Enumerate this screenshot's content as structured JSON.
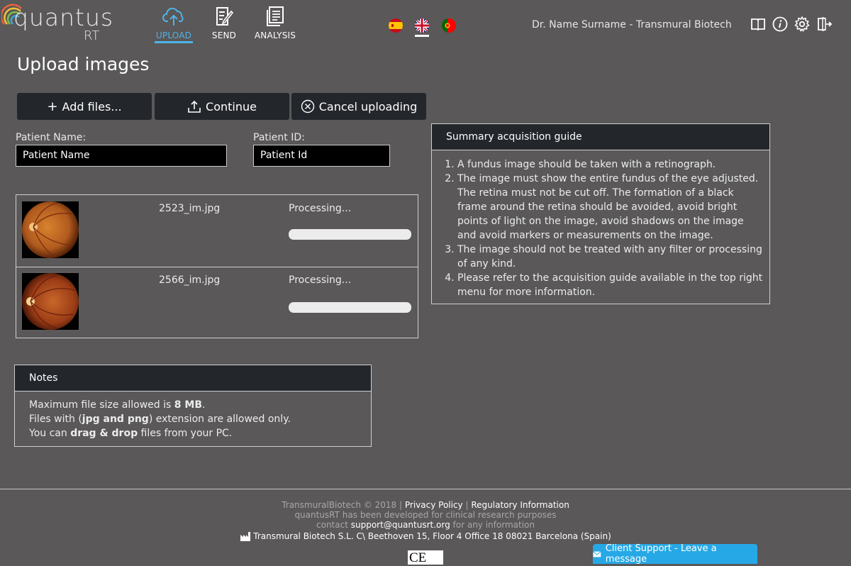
{
  "header": {
    "logo": {
      "word": "quantus",
      "suffix": "RT"
    },
    "nav": [
      {
        "label": "UPLOAD",
        "active": true
      },
      {
        "label": "SEND",
        "active": false
      },
      {
        "label": "ANALYSIS",
        "active": false
      }
    ],
    "languages": [
      "es",
      "en",
      "pt"
    ],
    "active_language": "en",
    "user": "Dr. Name Surname - Transmural Biotech",
    "icons": [
      "book-icon",
      "info-icon",
      "gear-icon",
      "logout-icon"
    ]
  },
  "page": {
    "title": "Upload images",
    "buttons": {
      "add": "Add files...",
      "continue": "Continue",
      "cancel": "Cancel uploading"
    },
    "patient_name": {
      "label": "Patient Name:",
      "value": "Patient Name"
    },
    "patient_id": {
      "label": "Patient ID:",
      "value": "Patient Id"
    },
    "files": [
      {
        "name": "2523_im.jpg",
        "status": "Processing..."
      },
      {
        "name": "2566_im.jpg",
        "status": "Processing..."
      }
    ]
  },
  "guide": {
    "title": "Summary acquisition guide",
    "items": [
      "A fundus image should be taken with a retinograph.",
      "The image must show the entire fundus of the eye adjusted. The retina must not be cut off. The formation of a black frame around the retina should be avoided, avoid bright points of light on the image, avoid shadows on the image and avoid markers or measurements on the image.",
      "The image should not be treated with any filter or processing of any kind.",
      "Please refer to the acquisition guide available in the top right menu for more information."
    ]
  },
  "notes": {
    "title": "Notes",
    "line1_pre": "Maximum file size allowed is ",
    "line1_bold": "8 MB",
    "line1_post": ".",
    "line2_pre": "Files with (",
    "line2_bold": "jpg and png",
    "line2_post": ") extension are allowed only.",
    "line3_pre": "You can ",
    "line3_bold": "drag & drop",
    "line3_post": " files from your PC."
  },
  "footer": {
    "copyright": "TransmuralBiotech © 2018 |",
    "privacy": "Privacy Policy",
    "sep": "|",
    "regulatory": "Regulatory Information",
    "research": "quantusRT has been developed for clinical research purposes",
    "contact_pre": "contact",
    "email": "support@quantusrt.org",
    "contact_post": "for any information",
    "address": "Transmural Biotech S.L. C\\ Beethoven 15, Floor 4 Office 18 08021 Barcelona (Spain)",
    "ce_mark": "CE"
  },
  "support": {
    "label": "Client Support - Leave a message"
  }
}
